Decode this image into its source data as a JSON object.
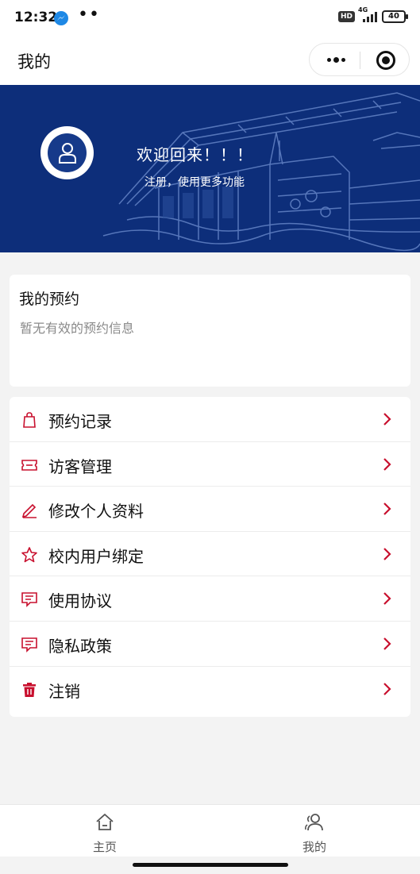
{
  "status_bar": {
    "time": "12:32",
    "notification_icon": "messenger-icon",
    "hd_badge": "HD",
    "network": "4G",
    "battery": "40"
  },
  "nav": {
    "title": "我的",
    "more_icon": "more-dots-icon",
    "close_icon": "target-circle-icon"
  },
  "hero": {
    "welcome": "欢迎回来！！！",
    "subtitle": "注册，使用更多功能",
    "background_color": "#0d2e7a",
    "avatar_icon": "user-avatar-icon"
  },
  "reservation": {
    "title": "我的预约",
    "empty_text": "暂无有效的预约信息"
  },
  "menu": {
    "accent_color": "#c8102e",
    "items": [
      {
        "label": "预约记录",
        "icon": "shopping-bag-icon"
      },
      {
        "label": "访客管理",
        "icon": "ticket-icon"
      },
      {
        "label": "修改个人资料",
        "icon": "pencil-icon"
      },
      {
        "label": "校内用户绑定",
        "icon": "star-icon"
      },
      {
        "label": "使用协议",
        "icon": "chat-bubble-icon"
      },
      {
        "label": "隐私政策",
        "icon": "chat-bubble-icon"
      },
      {
        "label": "注销",
        "icon": "trash-icon"
      }
    ]
  },
  "tabbar": {
    "tabs": [
      {
        "label": "主页",
        "icon": "home-icon"
      },
      {
        "label": "我的",
        "icon": "user-group-icon"
      }
    ]
  }
}
